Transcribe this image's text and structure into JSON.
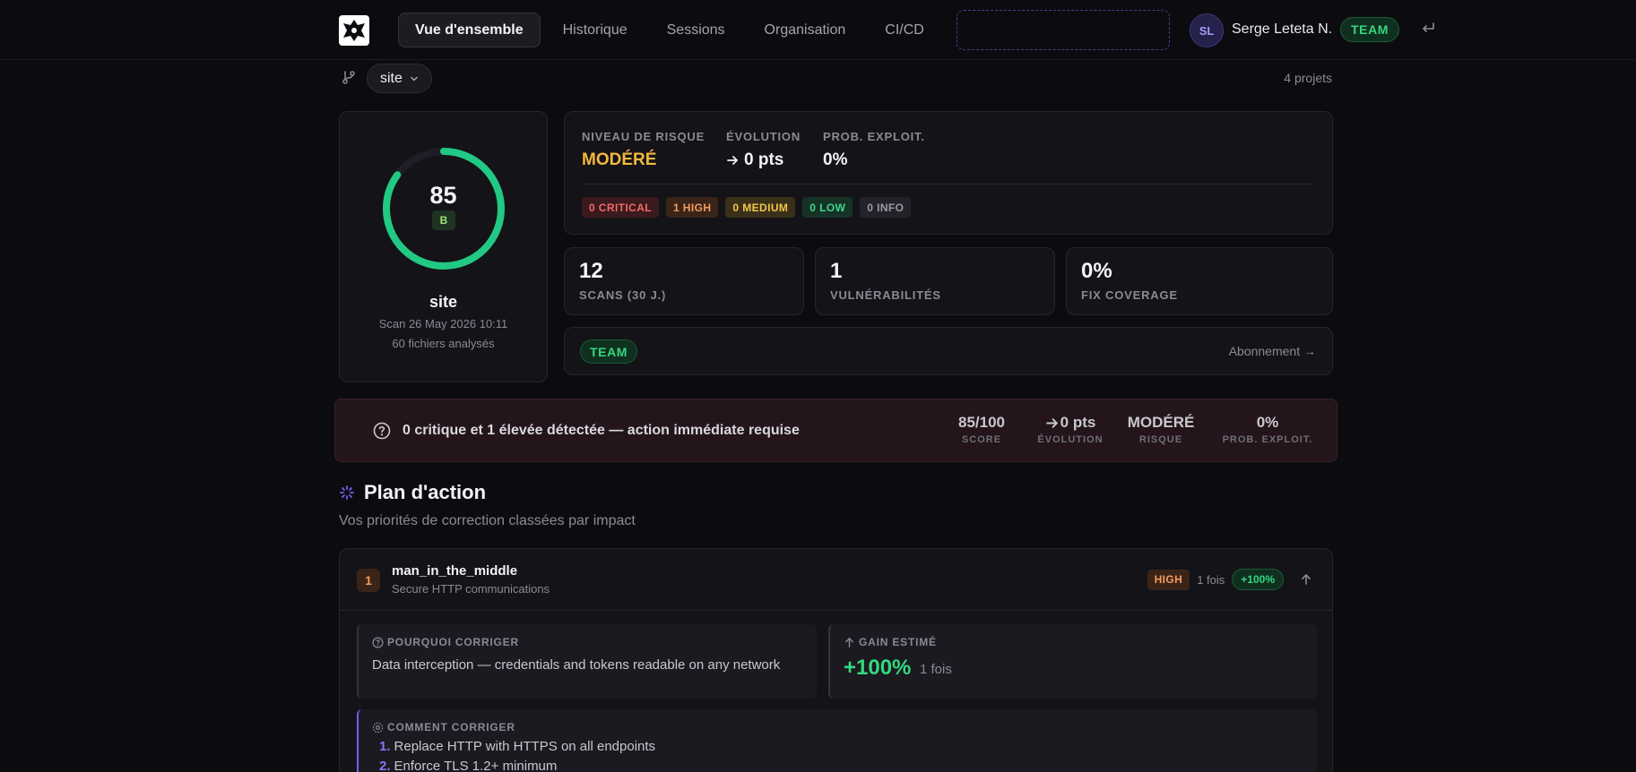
{
  "nav": {
    "tabs": [
      {
        "label": "Vue d'ensemble",
        "active": true
      },
      {
        "label": "Historique"
      },
      {
        "label": "Sessions"
      },
      {
        "label": "Organisation"
      },
      {
        "label": "CI/CD"
      }
    ],
    "user": {
      "initials": "SL",
      "name": "Serge Leteta N.",
      "plan": "TEAM"
    }
  },
  "project": {
    "name": "site",
    "count_label": "4 projets"
  },
  "score": {
    "value": 85,
    "grade": "B",
    "site": "site",
    "scan": "Scan 26 May 2026 10:11",
    "files": "60 fichiers analysés",
    "color": "#22c984"
  },
  "risk": {
    "level_label": "NIVEAU DE RISQUE",
    "level": "MODÉRÉ",
    "evolution_label": "ÉVOLUTION",
    "evolution": "0 pts",
    "exploit_label": "PROB. EXPLOIT.",
    "exploit": "0%",
    "severities": [
      {
        "label": "0 CRITICAL",
        "kind": "crit"
      },
      {
        "label": "1 HIGH",
        "kind": "high"
      },
      {
        "label": "0 MEDIUM",
        "kind": "med"
      },
      {
        "label": "0 LOW",
        "kind": "low"
      },
      {
        "label": "0 INFO",
        "kind": "info"
      }
    ]
  },
  "stats": [
    {
      "value": "12",
      "label": "SCANS (30 J.)"
    },
    {
      "value": "1",
      "label": "VULNÉRABILITÉS"
    },
    {
      "value": "0%",
      "label": "FIX COVERAGE"
    }
  ],
  "plan": {
    "badge": "TEAM",
    "link": "Abonnement →"
  },
  "alert": {
    "text": "0 critique et 1 élevée détectée — action immédiate requise",
    "metrics": [
      {
        "value": "85/100",
        "label": "SCORE"
      },
      {
        "value": "0 pts",
        "label": "ÉVOLUTION",
        "arrow": true
      },
      {
        "value": "MODÉRÉ",
        "label": "RISQUE"
      },
      {
        "value": "0%",
        "label": "PROB. EXPLOIT."
      }
    ]
  },
  "action_plan": {
    "title": "Plan d'action",
    "subtitle": "Vos priorités de correction classées par impact",
    "items": [
      {
        "rank": "1",
        "title": "man_in_the_middle",
        "subtitle": "Secure HTTP communications",
        "severity": "HIGH",
        "count": "1 fois",
        "gain": "+100%",
        "why_label": "POURQUOI CORRIGER",
        "why": "Data interception — credentials and tokens readable on any network",
        "gain_label": "GAIN ESTIMÉ",
        "gain_value": "+100%",
        "gain_count": "1 fois",
        "how_label": "COMMENT CORRIGER",
        "steps": [
          {
            "n": "1.",
            "text": "Replace HTTP with HTTPS on all endpoints"
          },
          {
            "n": "2.",
            "text": "Enforce TLS 1.2+ minimum"
          }
        ]
      }
    ]
  }
}
